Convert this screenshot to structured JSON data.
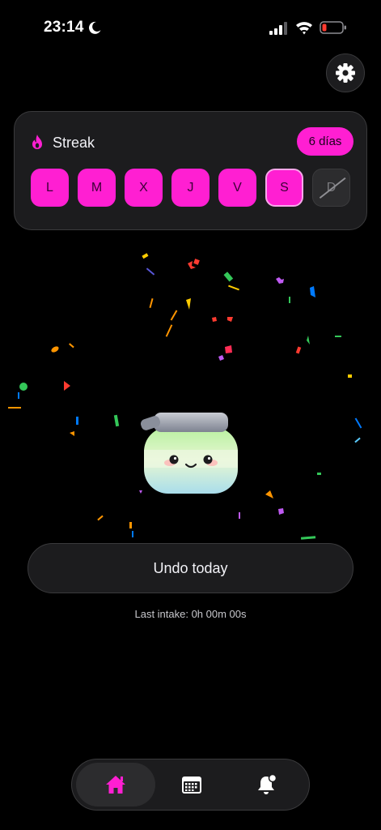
{
  "status_bar": {
    "time": "23:14",
    "icons": [
      "moon-icon",
      "cellular-signal-icon",
      "wifi-icon",
      "battery-low-icon"
    ],
    "battery_color": "#ff3b30"
  },
  "settings": {
    "icon": "gear-icon"
  },
  "streak": {
    "label": "Streak",
    "icon": "flame-icon",
    "badge": "6 días",
    "days": [
      {
        "label": "L",
        "state": "done"
      },
      {
        "label": "M",
        "state": "done"
      },
      {
        "label": "X",
        "state": "done"
      },
      {
        "label": "J",
        "state": "done"
      },
      {
        "label": "V",
        "state": "done"
      },
      {
        "label": "S",
        "state": "today"
      },
      {
        "label": "D",
        "state": "missed"
      }
    ]
  },
  "illustration": {
    "icon": "jar-icon"
  },
  "undo_button": {
    "label": "Undo today"
  },
  "last_intake": {
    "text": "Last intake: 0h 00m 00s"
  },
  "tab_bar": {
    "tabs": [
      {
        "name": "home",
        "icon": "home-icon",
        "active": true
      },
      {
        "name": "calendar",
        "icon": "calendar-icon",
        "active": false
      },
      {
        "name": "notifications",
        "icon": "bell-icon",
        "active": false
      }
    ]
  },
  "colors": {
    "accent": "#ff1fd2",
    "background": "#000000",
    "card": "#1c1c1e"
  }
}
